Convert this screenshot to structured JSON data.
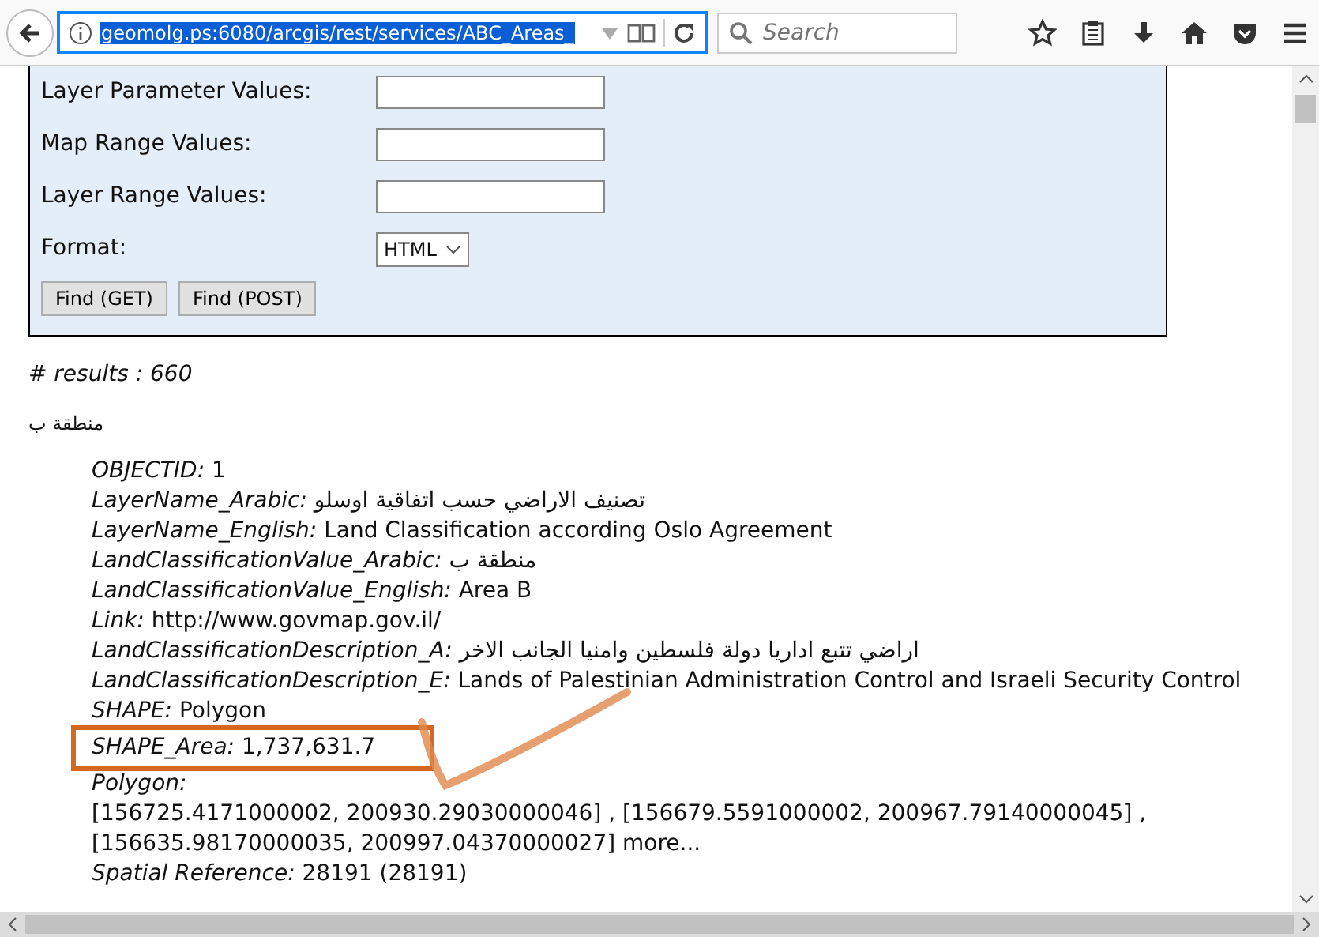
{
  "browser": {
    "url": "geomolg.ps:6080/arcgis/rest/services/ABC_Areas_",
    "search": {
      "placeholder": "Search"
    }
  },
  "form": {
    "fields": [
      {
        "label": "Layer Parameter Values:",
        "kind": "text"
      },
      {
        "label": "Map Range Values:",
        "kind": "text"
      },
      {
        "label": "Layer Range Values:",
        "kind": "text"
      },
      {
        "label": "Format:",
        "kind": "select",
        "value": "HTML"
      }
    ],
    "buttons": [
      "Find (GET)",
      "Find (POST)"
    ]
  },
  "results_count": "# results : 660",
  "result_title": "منطقة ب",
  "attributes": [
    {
      "name": "OBJECTID:",
      "value": "1",
      "highlighted": false
    },
    {
      "name": "LayerName_Arabic:",
      "value": "تصنيف الاراضي حسب اتفاقية اوسلو",
      "highlighted": false
    },
    {
      "name": "LayerName_English:",
      "value": "Land Classification according Oslo Agreement",
      "highlighted": false
    },
    {
      "name": "LandClassificationValue_Arabic:",
      "value": "منطقة ب",
      "highlighted": false
    },
    {
      "name": "LandClassificationValue_English:",
      "value": "Area B",
      "highlighted": false
    },
    {
      "name": "Link:",
      "value": "http://www.govmap.gov.il/",
      "highlighted": false
    },
    {
      "name": "LandClassificationDescription_A:",
      "value": "اراضي تتبع اداريا دولة فلسطين وامنيا الجانب الاخر",
      "highlighted": false
    },
    {
      "name": "LandClassificationDescription_E:",
      "value": "Lands of Palestinian Administration Control and Israeli Security Control",
      "highlighted": false
    },
    {
      "name": "SHAPE:",
      "value": "Polygon",
      "highlighted": false
    },
    {
      "name": "SHAPE_Area:",
      "value": "1,737,631.7",
      "highlighted": true
    },
    {
      "name": "Polygon:",
      "highlighted": false
    }
  ],
  "polygon_lines": [
    "[156725.4171000002, 200930.29030000046] , [156679.5591000002, 200967.79140000045] ,",
    "[156635.98170000035, 200997.04370000027] more..."
  ],
  "spatial_reference": {
    "name": "Spatial Reference:",
    "value": "28191  (28191)"
  }
}
